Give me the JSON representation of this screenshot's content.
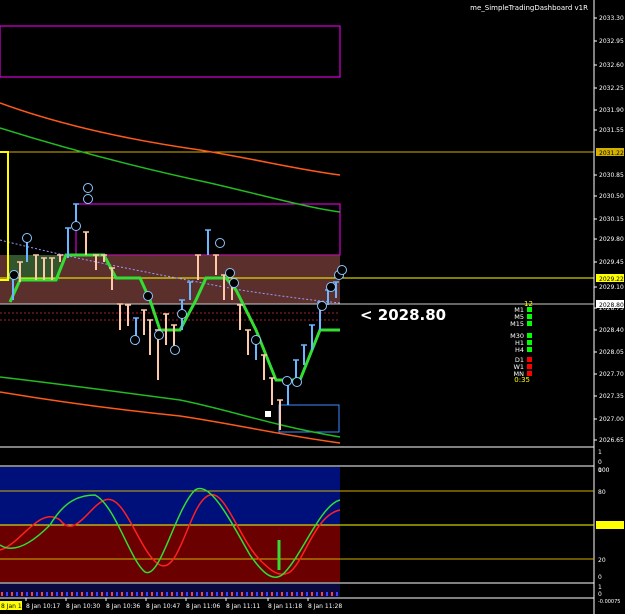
{
  "indicator_title": "me_SimpleTradingDashboard v1R",
  "price_axis": {
    "ticks": [
      "2033.30",
      "2032.95",
      "2032.60",
      "2032.25",
      "2031.90",
      "2031.55",
      "2030.85",
      "2030.50",
      "2030.15",
      "2029.80",
      "2029.45",
      "2029.10",
      "2028.75",
      "2028.40",
      "2028.05",
      "2027.70",
      "2027.35",
      "2027.00",
      "2026.65"
    ],
    "tag_gold": "2031.22",
    "tag_yellow": "2029.22",
    "tag_current": "2028.80"
  },
  "current_price_label": "<  2028.80",
  "dashboard": {
    "count": "12",
    "timeframes": [
      {
        "label": "M1",
        "color": "#00ff00"
      },
      {
        "label": "M5",
        "color": "#00ff00"
      },
      {
        "label": "M15",
        "color": "#00ff00"
      },
      {
        "label": "M30",
        "color": "#00ff00"
      },
      {
        "label": "H1",
        "color": "#00ff00"
      },
      {
        "label": "H4",
        "color": "#00ff00"
      },
      {
        "label": "D1",
        "color": "#ff0000"
      },
      {
        "label": "W1",
        "color": "#ff0000"
      },
      {
        "label": "MN",
        "color": "#ff0000"
      }
    ],
    "timer": "0:35"
  },
  "sub1_axis": [
    "1",
    "0",
    "0"
  ],
  "osc_axis": [
    "100",
    "80",
    "0.5031",
    "20",
    "0"
  ],
  "bottom_axis": [
    "1",
    "0",
    "-0.00075"
  ],
  "time_axis": {
    "first_tag": "8 Jan 10:13",
    "labels": [
      "8 Jan 10:17",
      "8 Jan 10:30",
      "8 Jan 10:36",
      "8 Jan 10:47",
      "8 Jan 11:06",
      "8 Jan 11:11",
      "8 Jan 11:18",
      "8 Jan 11:28"
    ]
  },
  "colors": {
    "bull_candle": "#ffc8a8",
    "bear_candle": "#6ab7ff",
    "green_line": "#33dd33",
    "ma_green": "#22aa22",
    "ma_orange": "#ff6a1a",
    "magenta": "#ff00ff",
    "osc_blue_zone": "#00107a",
    "osc_red_zone": "#6a0000"
  }
}
